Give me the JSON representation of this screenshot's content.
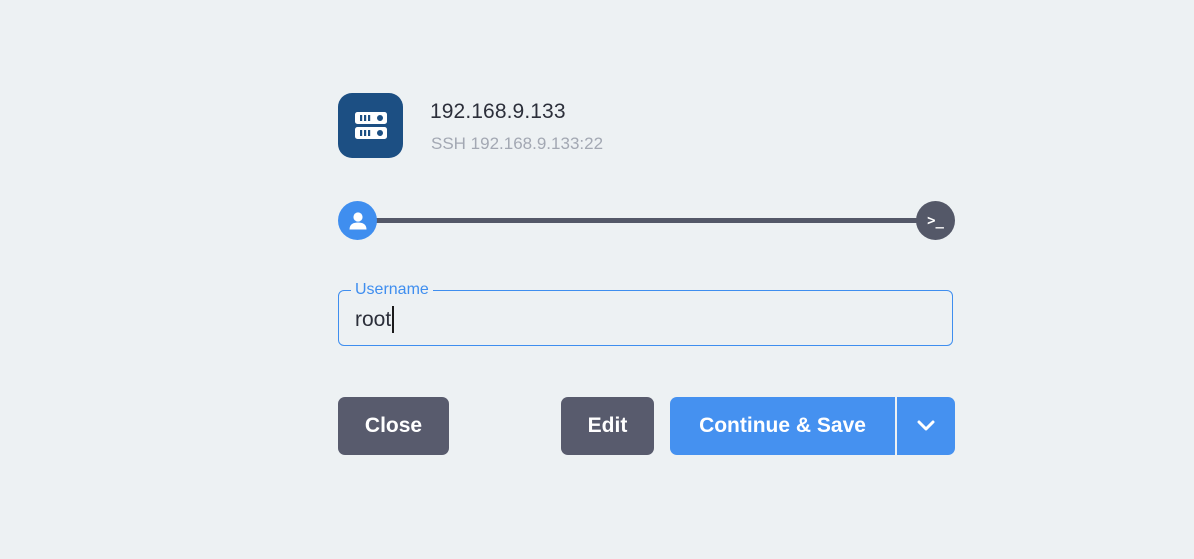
{
  "host": {
    "title": "192.168.9.133",
    "subtitle": "SSH 192.168.9.133:22",
    "icon": "server-icon",
    "icon_color": "#1c4f83"
  },
  "progress": {
    "steps": [
      {
        "icon": "user-icon",
        "state": "active",
        "color": "#3f8eef"
      },
      {
        "icon": "terminal-icon",
        "glyph": ">_",
        "state": "pending",
        "color": "#545868"
      }
    ]
  },
  "username_field": {
    "label": "Username",
    "value": "root",
    "accent": "#3f8eef"
  },
  "buttons": {
    "close": "Close",
    "edit": "Edit",
    "continue_save": "Continue & Save",
    "dropdown_icon": "chevron-down-icon",
    "primary_color": "#4591f0",
    "secondary_color": "#585b6d"
  }
}
